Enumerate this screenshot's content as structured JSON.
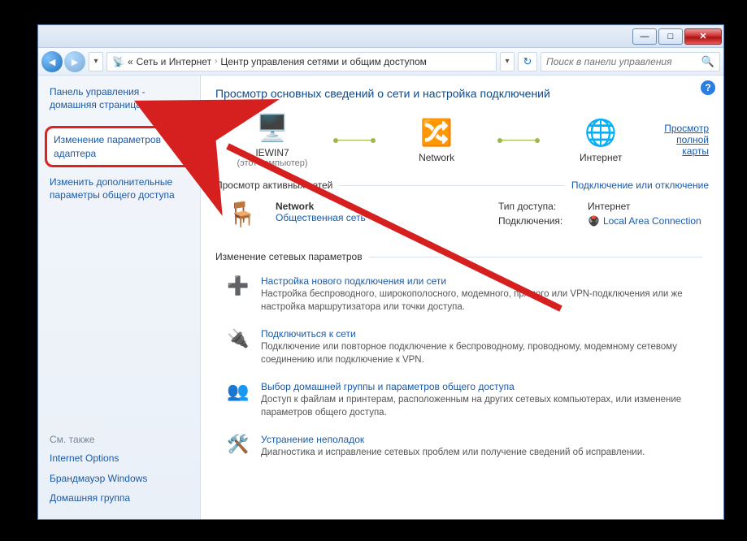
{
  "titlebar": {
    "minimize": "—",
    "maximize": "□",
    "close": "✕"
  },
  "breadcrumb": {
    "prefix_icon": "📡",
    "ellipsis": "«",
    "part1": "Сеть и Интернет",
    "sep": "›",
    "part2": "Центр управления сетями и общим доступом"
  },
  "search": {
    "placeholder": "Поиск в панели управления"
  },
  "sidebar": {
    "home": "Панель управления - домашняя страница",
    "adapter": "Изменение параметров адаптера",
    "advanced": "Изменить дополнительные параметры общего доступа",
    "see_also_title": "См. также",
    "see_also": {
      "internet_options": "Internet Options",
      "firewall": "Брандмауэр Windows",
      "homegroup": "Домашняя группа"
    }
  },
  "main": {
    "title": "Просмотр основных сведений о сети и настройка подключений",
    "map_link": "Просмотр полной карты",
    "map": {
      "node1_label": "IEWIN7",
      "node1_sub": "(этот компьютер)",
      "node2_label": "Network",
      "node3_label": "Интернет"
    },
    "active_header": "Просмотр активных сетей",
    "active_link": "Подключение или отключение",
    "active_net": {
      "name": "Network",
      "type_link": "Общественная сеть",
      "access_k": "Тип доступа:",
      "access_v": "Интернет",
      "conn_k": "Подключения:",
      "conn_v": "Local Area Connection"
    },
    "change_header": "Изменение сетевых параметров",
    "tasks": [
      {
        "title": "Настройка нового подключения или сети",
        "desc": "Настройка беспроводного, широкополосного, модемного, прямого или VPN-подключения или же настройка маршрутизатора или точки доступа."
      },
      {
        "title": "Подключиться к сети",
        "desc": "Подключение или повторное подключение к беспроводному, проводному, модемному сетевому соединению или подключение к VPN."
      },
      {
        "title": "Выбор домашней группы и параметров общего доступа",
        "desc": "Доступ к файлам и принтерам, расположенным на других сетевых компьютерах, или изменение параметров общего доступа."
      },
      {
        "title": "Устранение неполадок",
        "desc": "Диагностика и исправление сетевых проблем или получение сведений об исправлении."
      }
    ]
  }
}
